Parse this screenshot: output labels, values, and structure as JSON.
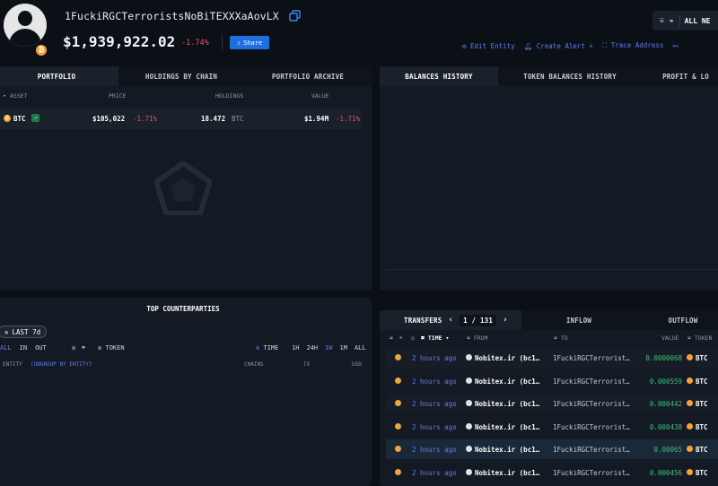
{
  "header": {
    "address": "1FuckiRGCTerroristsNoBiTEXXXaAovLX",
    "balance": "$1,939,922.02",
    "change": "-1.74%",
    "share_label": "Share",
    "network_filter": "ALL NE",
    "actions": [
      "Edit Entity",
      "Create Alert +",
      "Trace Address",
      ""
    ]
  },
  "portfolio": {
    "tabs": [
      "PORTFOLIO",
      "HOLDINGS BY CHAIN",
      "PORTFOLIO ARCHIVE"
    ],
    "columns": [
      "ASSET",
      "PRICE",
      "HOLDINGS",
      "VALUE"
    ],
    "rows": [
      {
        "asset": "BTC",
        "price": "$105,022",
        "price_change": "-1.71%",
        "holdings": "18.472",
        "unit": "BTC",
        "value": "$1.94M",
        "value_change": "-1.71%"
      }
    ]
  },
  "history": {
    "tabs": [
      "BALANCES HISTORY",
      "TOKEN BALANCES HISTORY",
      "PROFIT & LO"
    ]
  },
  "counterparties": {
    "title": "TOP COUNTERPARTIES",
    "chip": "LAST 7d",
    "flow_filters": [
      "ALL",
      "IN",
      "OUT"
    ],
    "token_label": "TOKEN",
    "time_label": "TIME",
    "time_ranges": [
      "1H",
      "24H",
      "1W",
      "1M",
      "ALL"
    ],
    "columns": {
      "entity": "ENTITY",
      "ungroup": "(UNGROUP BY ENTITY)",
      "chains": "CHAINS",
      "tx": "TX",
      "usd": "USD"
    }
  },
  "transfers": {
    "tabs": [
      "TRANSFERS",
      "INFLOW",
      "OUTFLOW"
    ],
    "page": "1",
    "page_sep": "/",
    "page_total": "131",
    "columns": [
      "TIME",
      "FROM",
      "TO",
      "VALUE",
      "TOKEN"
    ],
    "rows": [
      {
        "time": "2 hours ago",
        "from": "Nobitex.ir (bc1…",
        "to": "1FuckiRGCTerrorist…",
        "value": "0.0000068",
        "token": "BTC"
      },
      {
        "time": "2 hours ago",
        "from": "Nobitex.ir (bc1…",
        "to": "1FuckiRGCTerrorist…",
        "value": "0.000559",
        "token": "BTC"
      },
      {
        "time": "2 hours ago",
        "from": "Nobitex.ir (bc1…",
        "to": "1FuckiRGCTerrorist…",
        "value": "0.000442",
        "token": "BTC"
      },
      {
        "time": "2 hours ago",
        "from": "Nobitex.ir (bc1…",
        "to": "1FuckiRGCTerrorist…",
        "value": "0.000438",
        "token": "BTC"
      },
      {
        "time": "2 hours ago",
        "from": "Nobitex.ir (bc1…",
        "to": "1FuckiRGCTerrorist…",
        "value": "0.00065",
        "token": "BTC"
      },
      {
        "time": "2 hours ago",
        "from": "Nobitex.ir (bc1…",
        "to": "1FuckiRGCTerrorist…",
        "value": "0.000456",
        "token": "BTC"
      }
    ]
  },
  "colors": {
    "accent": "#1f6fe0",
    "negative": "#e0555f",
    "positive": "#3fbf7a",
    "btc": "#f2a33a"
  }
}
